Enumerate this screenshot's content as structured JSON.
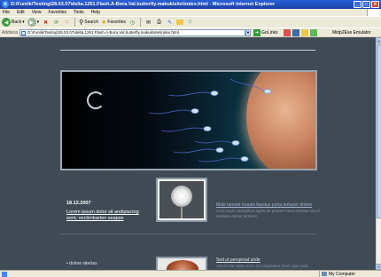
{
  "window": {
    "title": "D:\\Funtik\\Testing\\28.03.07\\delta.1261.Flash.A-Bora.Val.butterfly.makuk\\site\\index.html - Microsoft Internet Explorer",
    "minimize": "_",
    "maximize": "□",
    "close": "✕"
  },
  "menubar": {
    "items": [
      "File",
      "Edit",
      "View",
      "Favorites",
      "Tools",
      "Help"
    ]
  },
  "toolbar": {
    "back_label": "Back",
    "search_label": "Search",
    "favorites_label": "Favorites"
  },
  "addressbar": {
    "label": "Address",
    "value": "D:\\Funtik\\Testing\\28.03.07\\delta.1261.Flash.A-Bora.Val.butterfly.makuk\\site\\index.html",
    "go_label": "Go",
    "links_label": "Links",
    "emulator_label": "Midp2Exe Emulator"
  },
  "page": {
    "post": {
      "date": "18.12.2007",
      "link": "Lorem ipsum dolor sit andipiscing eent, vectimbarten seapse"
    },
    "blurb1": {
      "title": "Mole laoreet mauris faestus porta tertaner dolore",
      "text": "Cum soois natnatibus agnis de parture eneu nenose ras el nedetes duese lertanet"
    },
    "bullet": "▪ dolore sitertas",
    "blurb2": {
      "title": "Sed ut perspiciat unde",
      "text": "omnis iste natus error sit voluptatem mem rque tautt"
    }
  },
  "statusbar": {
    "zone": "My Computer"
  },
  "colors": {
    "page_bg": "#3f4a55",
    "title_bar": "#1941a5",
    "link_text": "#ffffff"
  }
}
